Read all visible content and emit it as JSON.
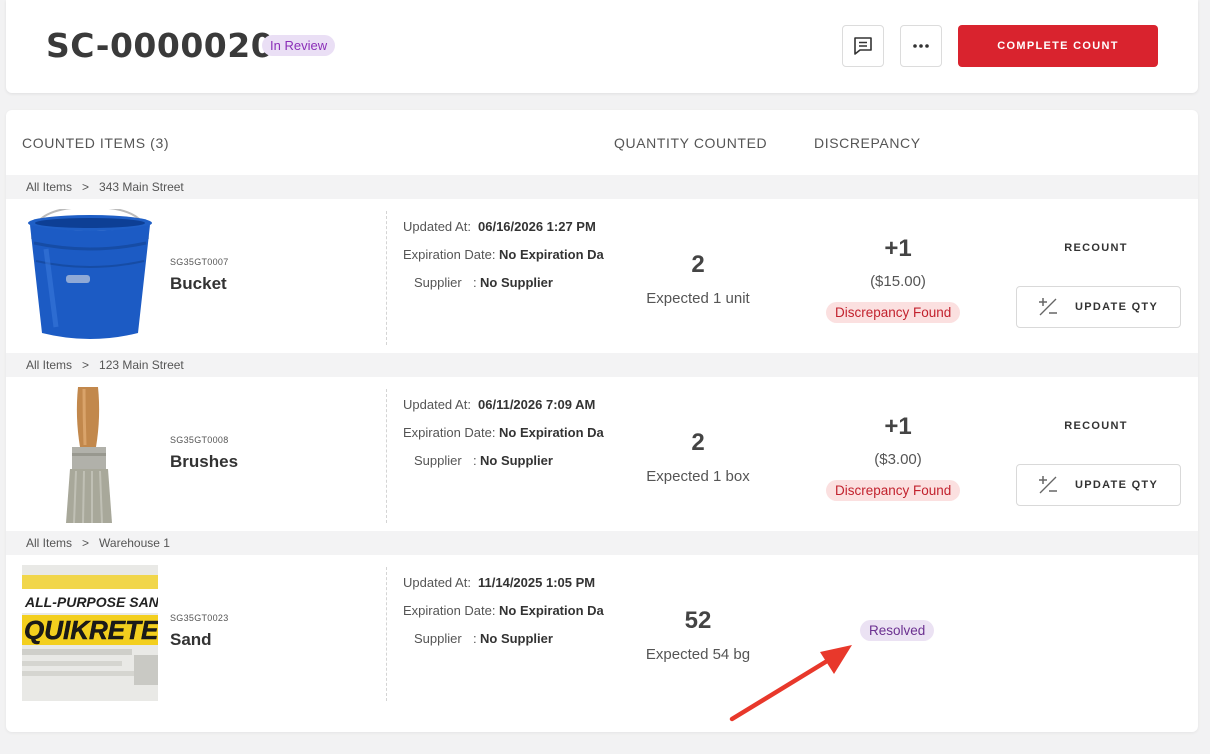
{
  "header": {
    "title": "SC-0000020",
    "status": "In Review",
    "complete_label": "COMPLETE COUNT",
    "comment_icon": "comment-icon",
    "more_icon": "more-horizontal-icon"
  },
  "columns": {
    "counted": "COUNTED ITEMS (3)",
    "quantity": "QUANTITY COUNTED",
    "discrepancy": "DISCREPANCY"
  },
  "labels": {
    "updated_at": "Updated At:",
    "expiration": "Expiration Date:",
    "supplier": "Supplier",
    "supplier_sep": ":",
    "recount": "RECOUNT",
    "update_qty": "UPDATE QTY"
  },
  "items": [
    {
      "crumb_root": "All Items",
      "crumb_sep": ">",
      "crumb_location": "343 Main Street",
      "sku": "SG35GT0007",
      "name": "Bucket",
      "updated_at": "06/16/2026 1:27 PM",
      "expiration": "No Expiration Da",
      "supplier": "No Supplier",
      "qty": "2",
      "expected": "Expected 1 unit",
      "discrepancy": "+1",
      "discrepancy_amount": "($15.00)",
      "status": "Discrepancy Found"
    },
    {
      "crumb_root": "All Items",
      "crumb_sep": ">",
      "crumb_location": "123 Main Street",
      "sku": "SG35GT0008",
      "name": "Brushes",
      "updated_at": "06/11/2026 7:09 AM",
      "expiration": "No Expiration Da",
      "supplier": "No Supplier",
      "qty": "2",
      "expected": "Expected 1 box",
      "discrepancy": "+1",
      "discrepancy_amount": "($3.00)",
      "status": "Discrepancy Found"
    },
    {
      "crumb_root": "All Items",
      "crumb_sep": ">",
      "crumb_location": "Warehouse 1",
      "sku": "SG35GT0023",
      "name": "Sand",
      "updated_at": "11/14/2025 1:05 PM",
      "expiration": "No Expiration Da",
      "supplier": "No Supplier",
      "qty": "52",
      "expected": "Expected 54 bg",
      "status": "Resolved",
      "image_text_line1": "ALL-PURPOSE SAN",
      "image_text_line2": "QUIKRETE"
    }
  ],
  "colors": {
    "accent": "#d9232e",
    "in_review_bg": "#eadff5",
    "in_review_text": "#8b2fb8",
    "discrepancy_bg": "#fbe0e0",
    "discrepancy_text": "#c2222e",
    "resolved_bg": "#ebe2f3",
    "resolved_text": "#6b3090",
    "annotation_arrow": "#e8382b"
  }
}
